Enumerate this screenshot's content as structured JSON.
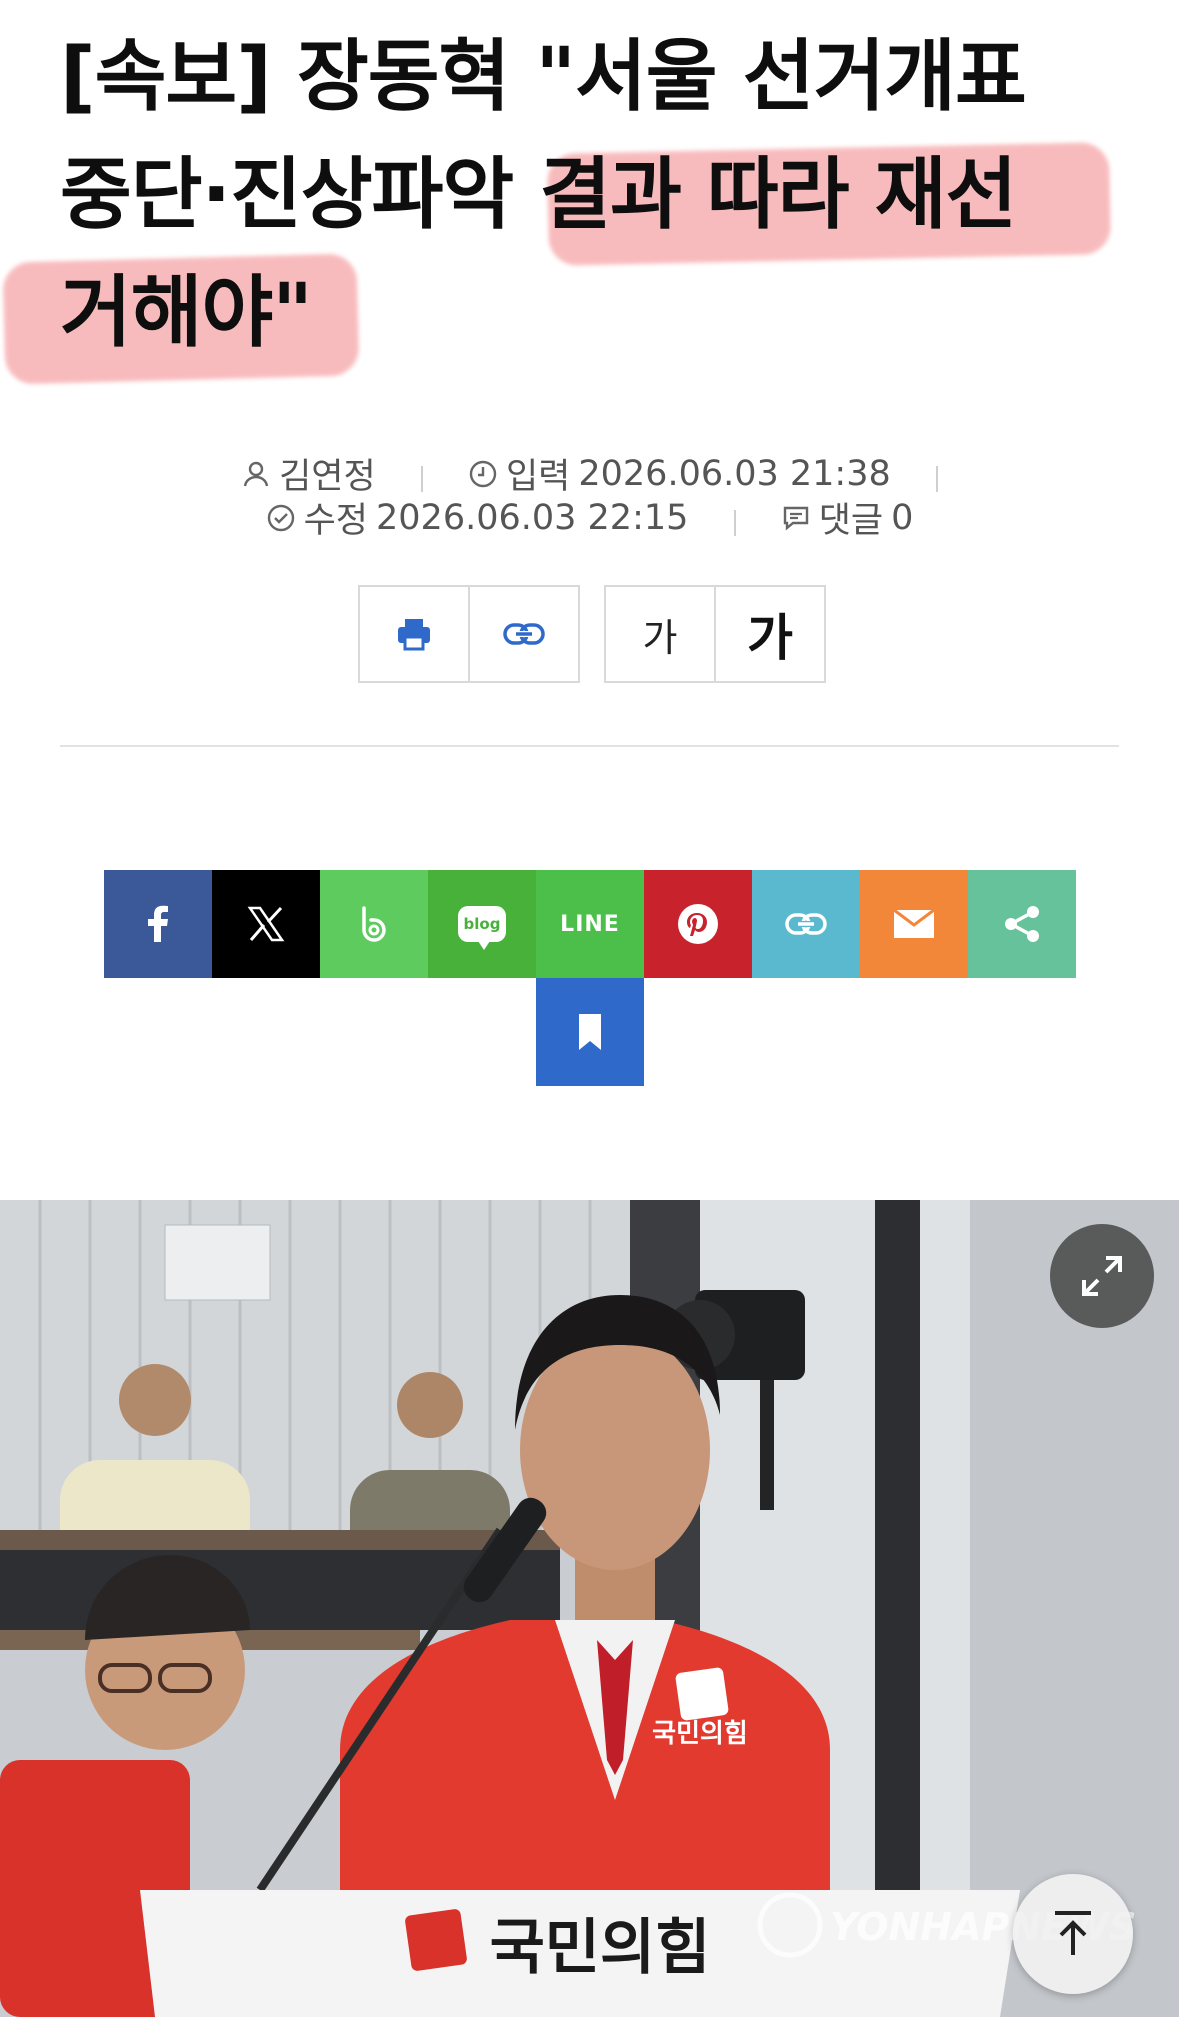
{
  "article": {
    "title_line1": "[속보] 장동혁 \"서울 선거개표",
    "title_line2a": "중단·진상파악 ",
    "title_line2b": "결과 따라 재선",
    "title_line3": "거해야\""
  },
  "meta": {
    "author": "김연정",
    "input_label": "입력",
    "input_time": "2026.06.03 21:38",
    "edit_label": "수정",
    "edit_time": "2026.06.03 22:15",
    "comment_label": "댓글",
    "comment_count": "0"
  },
  "tools": {
    "font_small": "가",
    "font_large": "가"
  },
  "share": {
    "line_label": "LINE",
    "blog_label": "blog",
    "colors": {
      "facebook": "#3b5998",
      "x": "#000000",
      "band": "#5ecb5e",
      "blog": "#47b13a",
      "line": "#4cbf4a",
      "pinterest": "#c8232c",
      "link": "#5ab9cf",
      "mail": "#f2873a",
      "share": "#66c29a",
      "bookmark": "#2f6acb"
    }
  },
  "photo": {
    "jacket_text": "국민의힘",
    "podium_text": "국민의힘",
    "watermark": "YONHAPNEWS"
  }
}
